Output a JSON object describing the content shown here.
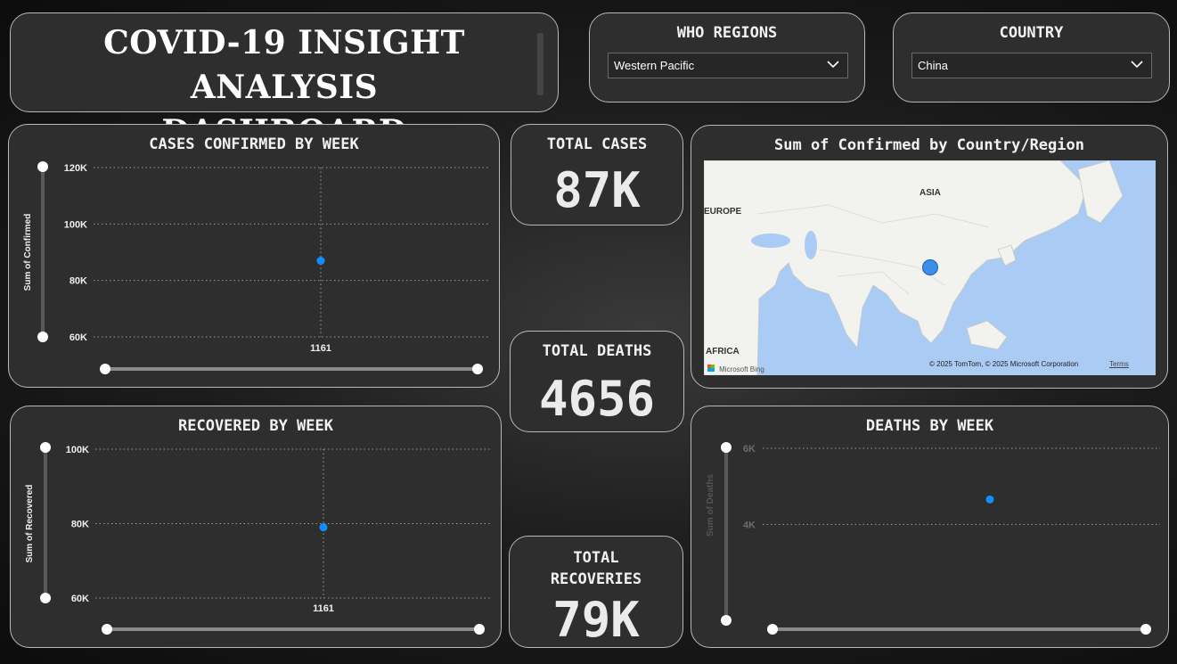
{
  "header": {
    "title_line1": "COVID-19  INSIGHT ANALYSIS",
    "title_line2": "DASHBOARD"
  },
  "filters": {
    "who_regions": {
      "label": "WHO REGIONS",
      "selected": "Western Pacific"
    },
    "country": {
      "label": "COUNTRY",
      "selected": "China"
    }
  },
  "kpis": {
    "total_cases": {
      "label": "TOTAL CASES",
      "value": "87K"
    },
    "total_deaths": {
      "label": "TOTAL DEATHS",
      "value": "4656"
    },
    "total_recoveries": {
      "label_line1": "TOTAL",
      "label_line2": "RECOVERIES",
      "value": "79K"
    }
  },
  "map": {
    "title": "Sum of Confirmed by Country/Region",
    "labels": {
      "asia": "ASIA",
      "europe": "EUROPE",
      "africa": "AFRICA"
    },
    "provider": "Microsoft Bing",
    "copyright": "© 2025 TomTom, © 2025 Microsoft Corporation",
    "terms": "Terms"
  },
  "colors": {
    "accent": "#118dff",
    "card_bg": "#2e2e2e",
    "border": "#b8b8b8"
  },
  "chart_data": [
    {
      "id": "confirmed",
      "type": "scatter",
      "title": "CASES CONFIRMED BY WEEK",
      "ylabel": "Sum of Confirmed",
      "x": [
        "1161"
      ],
      "series": [
        {
          "values": [
            87000
          ]
        }
      ],
      "ylim": [
        60000,
        120000
      ],
      "yticks": [
        60000,
        80000,
        100000,
        120000
      ],
      "ytick_labels": [
        "60K",
        "80K",
        "100K",
        "120K"
      ],
      "grid": true
    },
    {
      "id": "recovered",
      "type": "scatter",
      "title": "RECOVERED BY WEEK",
      "ylabel": "Sum of Recovered",
      "x": [
        "1161"
      ],
      "series": [
        {
          "values": [
            79000
          ]
        }
      ],
      "ylim": [
        60000,
        100000
      ],
      "yticks": [
        60000,
        80000,
        100000
      ],
      "ytick_labels": [
        "60K",
        "80K",
        "100K"
      ],
      "grid": true
    },
    {
      "id": "deaths",
      "type": "scatter",
      "title": "DEATHS BY WEEK",
      "ylabel": "Sum of Deaths",
      "x": [
        ""
      ],
      "series": [
        {
          "values": [
            4656
          ]
        }
      ],
      "ylim": [
        3000,
        6000
      ],
      "yticks": [
        4000,
        6000
      ],
      "ytick_labels": [
        "4K",
        "6K"
      ],
      "grid": true
    }
  ]
}
